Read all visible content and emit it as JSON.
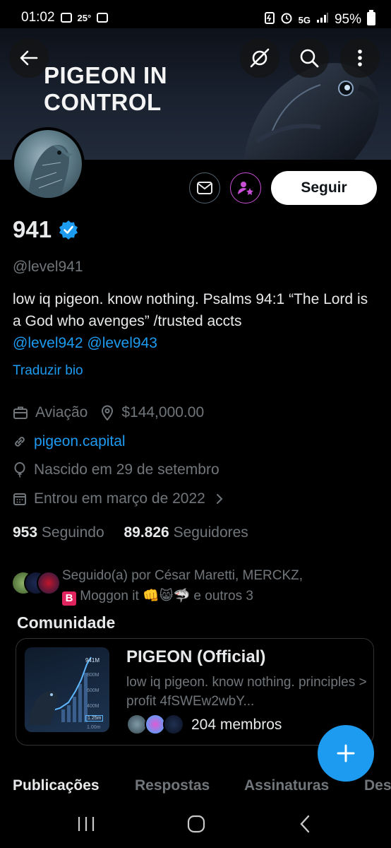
{
  "status_bar": {
    "time": "01:02",
    "temperature": "25°",
    "battery": "95%",
    "network": "5G"
  },
  "banner": {
    "title": "PIGEON IN CONTROL"
  },
  "profile": {
    "name": "941",
    "handle": "@level941",
    "bio_text": "low iq pigeon. know nothing. Psalms 94:1 “The Lord is a God who avenges” /trusted accts",
    "bio_link_1": "@level942",
    "bio_link_2": "@level943",
    "translate_label": "Traduzir bio",
    "category": "Aviação",
    "location": "$144,000.00",
    "website": "pigeon.capital",
    "birthday": "Nascido em 29 de setembro",
    "joined": "Entrou em março de 2022"
  },
  "actions": {
    "follow_label": "Seguir"
  },
  "stats": {
    "following_count": "953",
    "following_label": "Seguindo",
    "followers_count": "89.826",
    "followers_label": "Seguidores"
  },
  "followed_by": {
    "line1": "Seguido(a) por César Maretti, MERCKZ,",
    "line2_name": "Moggon it",
    "line2_emojis": "👊😸🦈",
    "line2_rest": "e outros 3",
    "badge_letter": "B"
  },
  "community": {
    "section_title": "Comunidade",
    "name": "PIGEON (Official)",
    "description": "low iq pigeon. know nothing. principles > profit 4fSWEw2wbY...",
    "members": "204 membros",
    "thumb_labels": [
      "941M",
      "800M",
      "600M",
      "400M",
      "1.25m",
      "1.00m"
    ]
  },
  "tabs": [
    "Publicações",
    "Respostas",
    "Assinaturas",
    "Des"
  ],
  "colors": {
    "accent": "#1d9bf0",
    "muted": "#71767b",
    "background": "#000000",
    "subscribe_purple": "#c94fd6"
  }
}
